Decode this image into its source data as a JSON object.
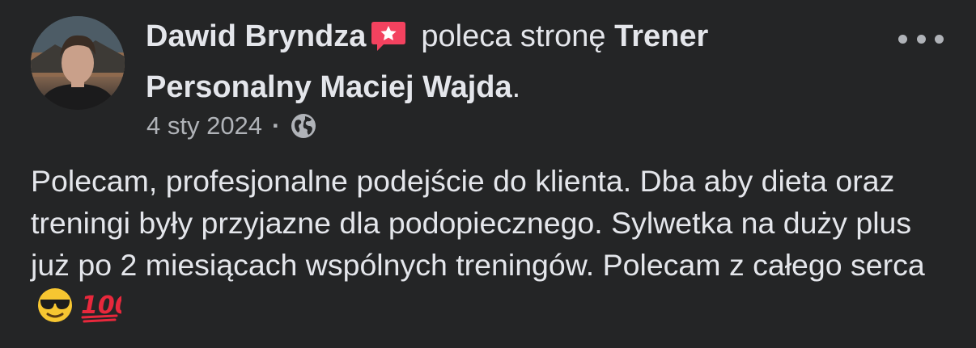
{
  "post": {
    "author": "Dawid Bryndza",
    "verb": "poleca stronę",
    "page_name": "Trener Personalny Maciej Wajda",
    "page_suffix": ".",
    "date": "4 sty 2024",
    "separator": "·",
    "audience_icon": "globe-icon",
    "badge_icon": "recommendation-star-icon",
    "more_icon": "more-options-icon",
    "text": "Polecam, profesjonalne podejście do klienta. Dba aby dieta oraz treningi były przyjazne dla podopiecznego. Sylwetka na duży plus już po 2 miesiącach wspólnych treningów. Polecam z całego serca",
    "emojis": [
      "sunglasses-face-emoji",
      "hundred-points-emoji"
    ]
  },
  "colors": {
    "background": "#242526",
    "primary_text": "#e4e6eb",
    "secondary_text": "#b0b3b8",
    "badge": "#f3425f"
  }
}
